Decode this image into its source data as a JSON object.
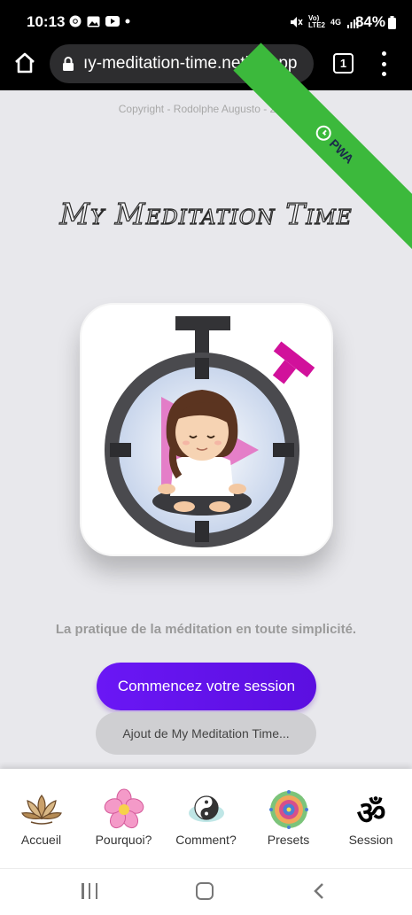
{
  "status_bar": {
    "time": "10:13",
    "signal_label_top": "Vo)",
    "signal_label_bottom": "LTE2",
    "network": "4G",
    "battery": "84%",
    "icons": [
      "chrome-icon",
      "image-icon",
      "youtube-icon",
      "dot-icon",
      "mute-icon",
      "signal-icon",
      "battery-icon"
    ]
  },
  "browser": {
    "url": "ıy-meditation-time.netlify.app",
    "tab_count": "1",
    "icons": [
      "home-icon",
      "lock-icon",
      "tabs-icon",
      "more-vertical-icon"
    ]
  },
  "page": {
    "copyright": "Copyright - Rodolphe Augusto - 2021",
    "pwa_ribbon": "PWA",
    "title": "My Meditation Time",
    "tagline": "La pratique de la méditation en toute simplicité.",
    "start_button": "Commencez votre session",
    "install_button": "Ajout de My Meditation Time..."
  },
  "bottom_nav": {
    "items": [
      {
        "label": "Accueil",
        "icon": "lotus-icon"
      },
      {
        "label": "Pourquoi?",
        "icon": "flower-icon"
      },
      {
        "label": "Comment?",
        "icon": "yin-yang-icon"
      },
      {
        "label": "Presets",
        "icon": "mandala-icon"
      },
      {
        "label": "Session",
        "icon": "om-icon"
      }
    ]
  },
  "colors": {
    "accent": "#6a17f5",
    "ribbon": "#3cb93c",
    "background": "#e8e8ec",
    "magenta": "#d1119b"
  }
}
